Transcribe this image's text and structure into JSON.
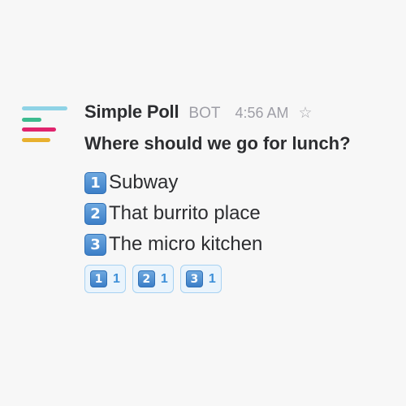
{
  "message": {
    "sender": "Simple Poll",
    "tag": "BOT",
    "time": "4:56 AM",
    "star_icon": "star-outline-icon",
    "avatar_icon": "simple-poll-logo",
    "question": "Where should we go for lunch?",
    "options": [
      {
        "emoji": "1",
        "label": "Subway"
      },
      {
        "emoji": "2",
        "label": "That burrito place"
      },
      {
        "emoji": "3",
        "label": "The micro kitchen"
      }
    ],
    "reactions": [
      {
        "emoji": "1",
        "count": "1"
      },
      {
        "emoji": "2",
        "count": "1"
      },
      {
        "emoji": "3",
        "count": "1"
      }
    ]
  },
  "colors": {
    "logo_bar_1": "#8fd3e6",
    "logo_bar_2": "#3dbb8f",
    "logo_bar_3": "#e0246d",
    "logo_bar_4": "#e8b02e",
    "reaction_count": "#3d8fd8",
    "reaction_border": "#a8d2f2"
  }
}
